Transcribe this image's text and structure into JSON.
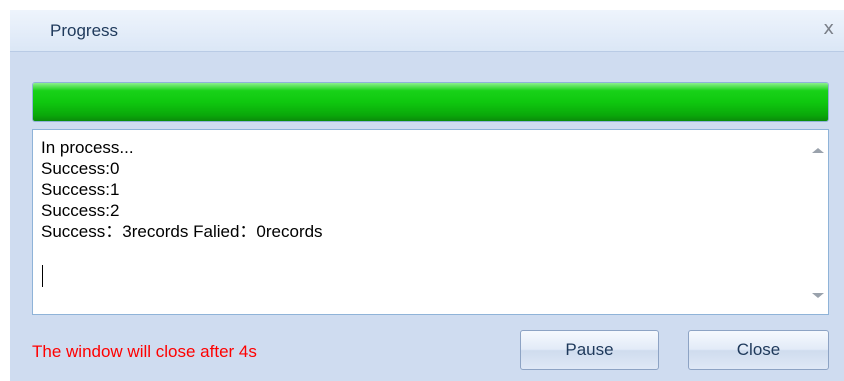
{
  "window": {
    "title": "Progress",
    "close_glyph": "x"
  },
  "progress": {
    "fraction": 1.0,
    "color": "#10c810"
  },
  "log": {
    "lines": [
      "In process...",
      "Success:0",
      "Success:1",
      "Success:2",
      "Success：3records Falied：0records"
    ]
  },
  "status": {
    "message": "The window will close after 4s",
    "color": "#ff0000"
  },
  "buttons": {
    "pause_label": "Pause",
    "close_label": "Close"
  },
  "icons": {
    "close": "close-icon",
    "scroll_up": "scroll-up-arrow-icon",
    "scroll_down": "scroll-down-arrow-icon"
  }
}
